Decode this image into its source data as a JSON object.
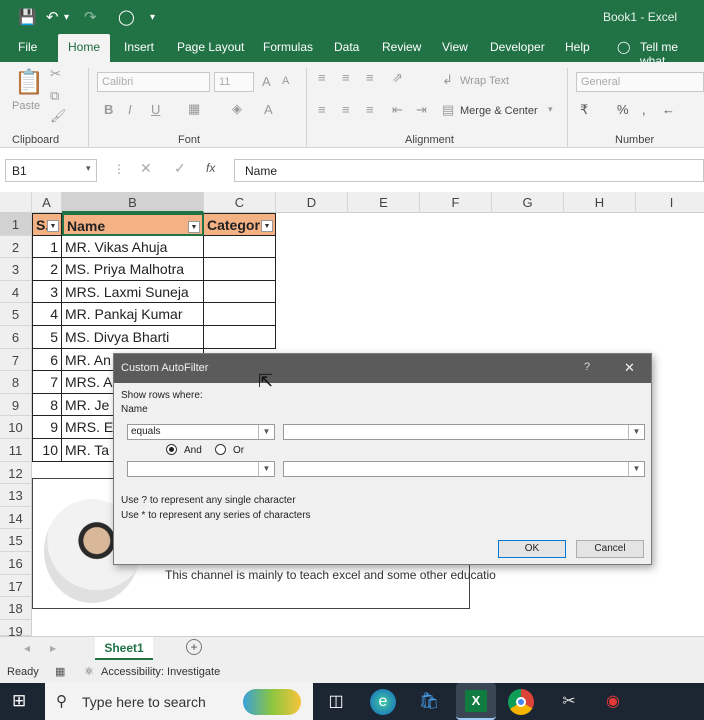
{
  "window": {
    "title": "Book1  -  Excel"
  },
  "tabs": [
    "File",
    "Home",
    "Insert",
    "Page Layout",
    "Formulas",
    "Data",
    "Review",
    "View",
    "Developer",
    "Help",
    "Tell me what"
  ],
  "ribbon": {
    "paste_label": "Paste",
    "font_name": "Calibri",
    "font_size": "11",
    "wrap_text": "Wrap Text",
    "merge_center": "Merge & Center",
    "number_format": "General",
    "groups": {
      "clipboard": "Clipboard",
      "font": "Font",
      "alignment": "Alignment",
      "number": "Number"
    }
  },
  "formula_bar": {
    "name_box": "B1",
    "content": "Name"
  },
  "columns": [
    "A",
    "B",
    "C",
    "D",
    "E",
    "F",
    "G",
    "H",
    "I"
  ],
  "rows": [
    "1",
    "2",
    "3",
    "4",
    "5",
    "6",
    "7",
    "8",
    "9",
    "10",
    "11",
    "12",
    "13",
    "14",
    "15",
    "16",
    "17",
    "18",
    "19"
  ],
  "table": {
    "headers": [
      "S.",
      "Name",
      "Categor"
    ],
    "records": [
      {
        "sn": "1",
        "name": "MR. Vikas Ahuja"
      },
      {
        "sn": "2",
        "name": "MS. Priya Malhotra"
      },
      {
        "sn": "3",
        "name": "MRS. Laxmi Suneja"
      },
      {
        "sn": "4",
        "name": "MR. Pankaj Kumar"
      },
      {
        "sn": "5",
        "name": "MS. Divya Bharti"
      },
      {
        "sn": "6",
        "name": "MR. An"
      },
      {
        "sn": "7",
        "name": "MRS. A"
      },
      {
        "sn": "8",
        "name": "MR. Je"
      },
      {
        "sn": "9",
        "name": "MRS. E"
      },
      {
        "sn": "10",
        "name": "MR. Ta"
      }
    ]
  },
  "channel_banner": "This channel is mainly to teach excel and some other educatio",
  "dialog": {
    "title": "Custom AutoFilter",
    "help": "?",
    "close": "✕",
    "show_rows": "Show rows where:",
    "field": "Name",
    "operator1": "equals",
    "and_label": "And",
    "or_label": "Or",
    "hint1": "Use ? to represent any single character",
    "hint2": "Use * to represent any series of characters",
    "ok": "OK",
    "cancel": "Cancel"
  },
  "sheet_tab": "Sheet1",
  "status": {
    "ready": "Ready",
    "accessibility": "Accessibility: Investigate"
  },
  "taskbar": {
    "search_placeholder": "Type here to search"
  }
}
